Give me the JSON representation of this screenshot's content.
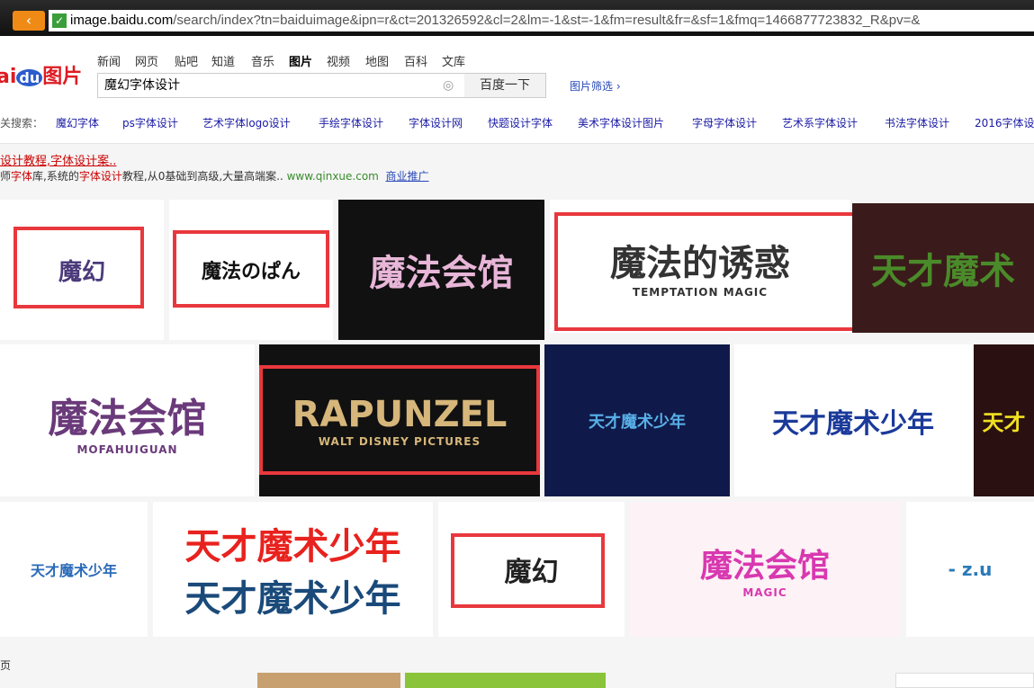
{
  "browser": {
    "back_icon": "‹",
    "secure_icon": "✓",
    "url_host": "image.baidu.com",
    "url_path": "/search/index?tn=baiduimage&ipn=r&ct=201326592&cl=2&lm=-1&st=-1&fm=result&fr=&sf=1&fmq=1466877723832_R&pv=&"
  },
  "header": {
    "logo_text": "ai",
    "logo_du": "du",
    "logo_suffix": "图片",
    "nav": [
      "新闻",
      "网页",
      "贴吧",
      "知道",
      "音乐",
      "图片",
      "视频",
      "地图",
      "百科",
      "文库"
    ],
    "nav_active": "图片",
    "search_value": "魔幻字体设计",
    "camera_icon": "◎",
    "search_button": "百度一下",
    "filter_label": "图片筛选 ›"
  },
  "related": {
    "label": "关搜索：",
    "items": [
      "魔幻字体",
      "ps字体设计",
      "艺术字体logo设计",
      "手绘字体设计",
      "字体设计网",
      "快题设计字体",
      "美术字体设计图片",
      "字母字体设计",
      "艺术系字体设计",
      "书法字体设计",
      "2016字体设"
    ]
  },
  "ad": {
    "title": "设计教程,字体设计案..",
    "desc_parts": [
      "师",
      "字体",
      "库,系统的",
      "字体设计",
      "教程,从0基础到高级,大量高端案.."
    ],
    "site": "www.qinxue.com",
    "promo": "商业推广"
  },
  "images": [
    {
      "text": "魔幻",
      "bg": "#ffffff",
      "fg": "#4a3a7a"
    },
    {
      "text": "魔法のぱん",
      "bg": "#ffffff",
      "fg": "#111111"
    },
    {
      "text": "魔法会馆",
      "bg": "#111111",
      "fg": "#e8b6d8"
    },
    {
      "text": "魔法的诱惑",
      "sub": "TEMPTATION MAGIC",
      "bg": "#ffffff",
      "fg": "#333333"
    },
    {
      "text": "天才魔术",
      "bg": "#3a1a1a",
      "fg": "#4a8a2a"
    },
    {
      "text": "魔法会馆",
      "sub": "MOFAHUIGUAN",
      "bg": "#ffffff",
      "fg": "#6a3a7a"
    },
    {
      "text": "RAPUNZEL",
      "sub": "WALT DISNEY PICTURES",
      "bg": "#111111",
      "fg": "#d6b67a"
    },
    {
      "text": "天才魔术少年",
      "bg": "#101a4a",
      "fg": "#58b0e8"
    },
    {
      "text": "天才魔术少年",
      "bg": "#ffffff",
      "fg": "#1a3a9a"
    },
    {
      "text": "天才",
      "bg": "#2a1010",
      "fg": "#f0e020"
    },
    {
      "text": "天才魔术少年",
      "bg": "#ffffff",
      "fg": "#2a6ab8"
    },
    {
      "text": "天才魔术少年",
      "text2": "天才魔术少年",
      "bg": "#ffffff",
      "fg": "#e8221e",
      "fg2": "#1a4a7a"
    },
    {
      "text": "魔幻",
      "bg": "#ffffff",
      "fg": "#222222"
    },
    {
      "text": "魔法会馆",
      "sub": "MAGIC",
      "bg": "#fdf2f6",
      "fg": "#d838b0"
    },
    {
      "text": "- z.u",
      "bg": "#ffffff",
      "fg": "#2a7ab8"
    }
  ],
  "pager_text": "页"
}
